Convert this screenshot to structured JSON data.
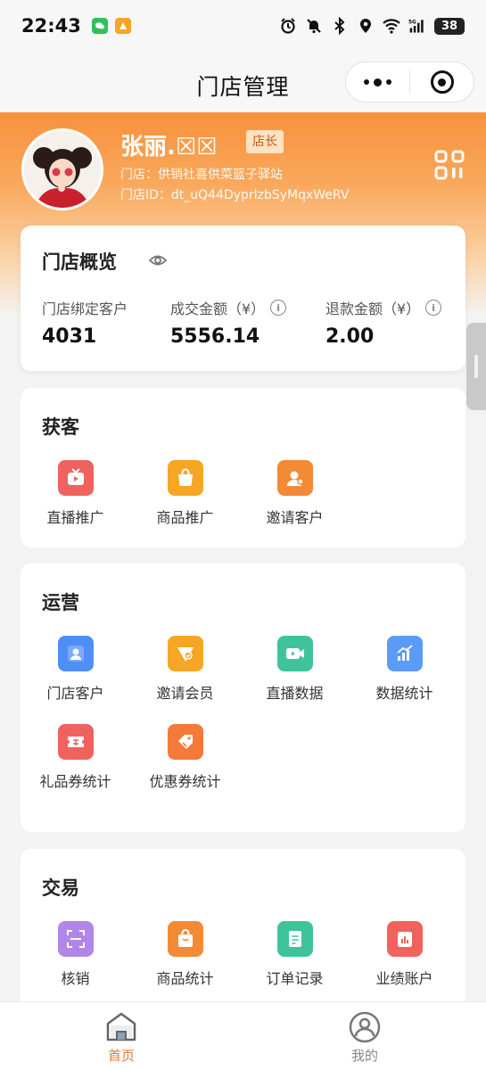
{
  "status_bar": {
    "time": "22:43",
    "battery": "38",
    "signal": "5G"
  },
  "nav": {
    "title": "门店管理"
  },
  "profile": {
    "name": "张丽.☒☒",
    "role": "店长",
    "store": "门店：供销社喜供菜篮子驿站",
    "store_id": "门店ID：dt_uQ44DyprlzbSyMqxWeRV"
  },
  "overview": {
    "title": "门店概览",
    "stats": [
      {
        "label": "门店绑定客户",
        "value": "4031"
      },
      {
        "label": "成交金额（¥）",
        "value": "5556.14"
      },
      {
        "label": "退款金额（¥）",
        "value": "2.00"
      }
    ]
  },
  "sections": {
    "acquire": {
      "title": "获客",
      "items": [
        {
          "label": "直播推广",
          "icon": "tv-icon",
          "color": "#f0625e"
        },
        {
          "label": "商品推广",
          "icon": "bag-icon",
          "color": "#f5a623"
        },
        {
          "label": "邀请客户",
          "icon": "user-chat-icon",
          "color": "#f28a36"
        }
      ]
    },
    "operate": {
      "title": "运营",
      "items": [
        {
          "label": "门店客户",
          "icon": "person-icon",
          "color": "#4f8ef7"
        },
        {
          "label": "邀请会员",
          "icon": "member-icon",
          "color": "#f5a623"
        },
        {
          "label": "直播数据",
          "icon": "video-icon",
          "color": "#3fc39b"
        },
        {
          "label": "数据统计",
          "icon": "chart-icon",
          "color": "#5a9cf5"
        },
        {
          "label": "礼品券统计",
          "icon": "ticket-icon",
          "color": "#f0625e"
        },
        {
          "label": "优惠券统计",
          "icon": "coupon-icon",
          "color": "#f5793a"
        }
      ]
    },
    "trade": {
      "title": "交易",
      "items": [
        {
          "label": "核销",
          "icon": "scan-icon",
          "color": "#b286e8"
        },
        {
          "label": "商品统计",
          "icon": "shopping-bag-icon",
          "color": "#f28a36"
        },
        {
          "label": "订单记录",
          "icon": "document-icon",
          "color": "#3fc39b"
        },
        {
          "label": "业绩账户",
          "icon": "wallet-icon",
          "color": "#f0625e"
        }
      ]
    }
  },
  "tabs": [
    {
      "label": "首页",
      "active": true,
      "color": "#e8772e"
    },
    {
      "label": "我的",
      "active": false,
      "color": "#888888"
    }
  ]
}
